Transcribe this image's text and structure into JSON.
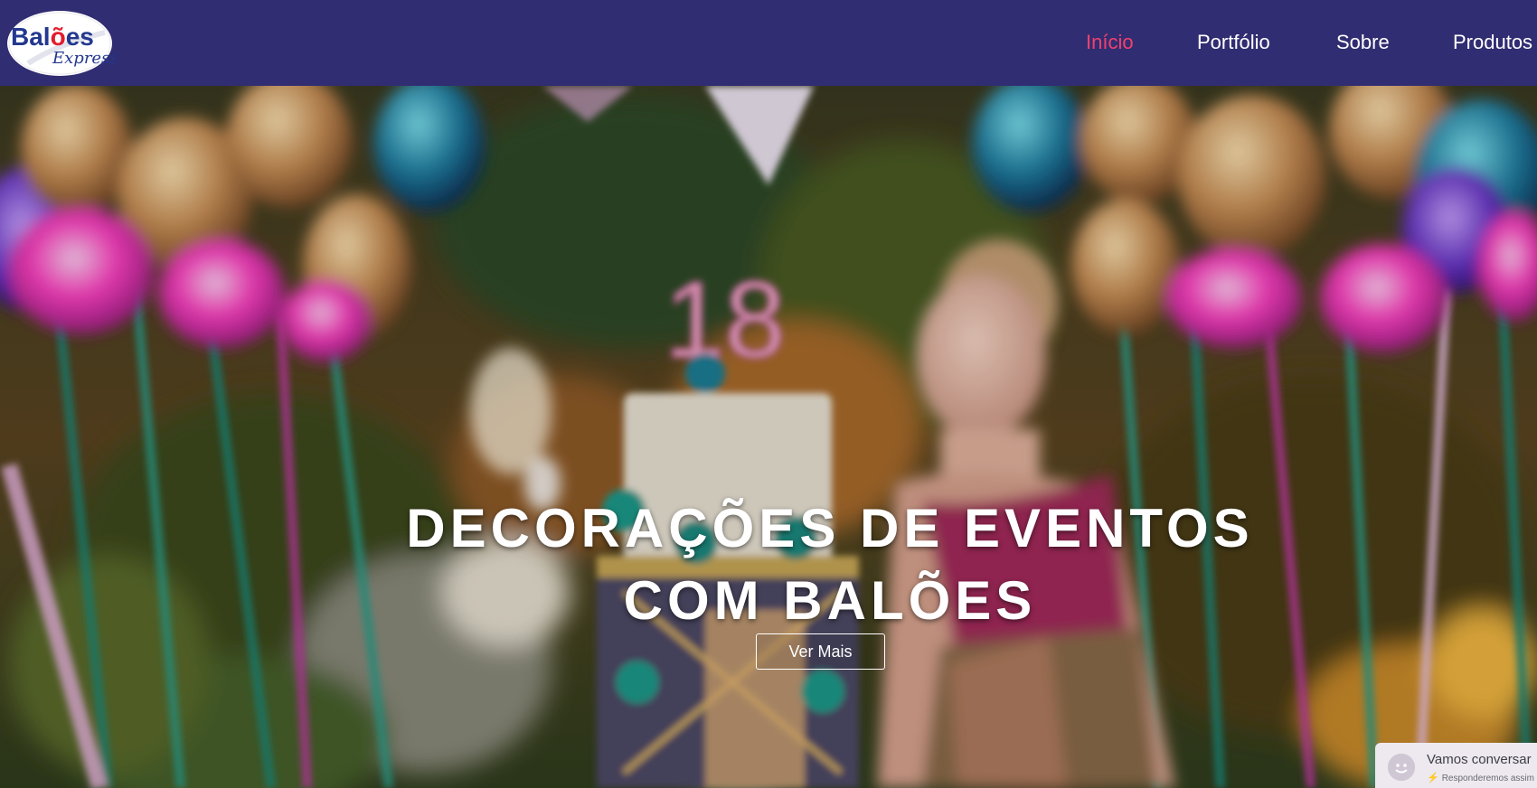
{
  "brand": {
    "logo_text_main": "Balões",
    "logo_text_sub": "Express"
  },
  "nav": {
    "items": [
      {
        "label": "Início",
        "active": true
      },
      {
        "label": "Portfólio",
        "active": false
      },
      {
        "label": "Sobre",
        "active": false
      },
      {
        "label": "Produtos",
        "active": false
      }
    ]
  },
  "hero": {
    "title_line1": "DECORAÇÕES DE EVENTOS",
    "title_line2": "COM BALÕES",
    "cta_label": "Ver Mais",
    "cake_number": "18"
  },
  "chat": {
    "title": "Vamos conversar",
    "subtitle": "Responderemos assim q"
  },
  "colors": {
    "header_bg": "#312d72",
    "nav_active": "#f0416d",
    "nav_text": "#ffffff",
    "chat_bg": "#ede9ef"
  }
}
